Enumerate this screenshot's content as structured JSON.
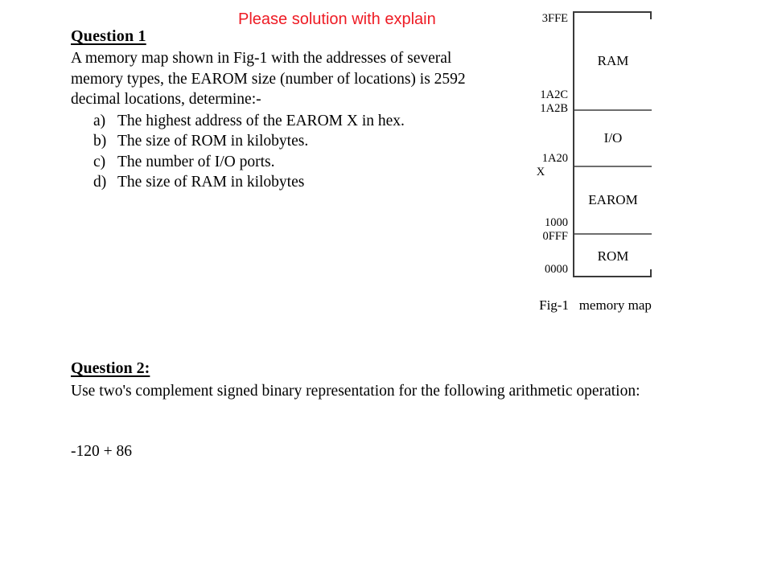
{
  "annotation": {
    "text": "Please solution with explain",
    "color": "#EE1B24"
  },
  "question1": {
    "heading": "Question 1",
    "paragraph": "A memory map shown  in Fig-1  with the addresses of several memory types, the  EAROM size (number of locations) is 2592 decimal locations, determine:-",
    "items": [
      {
        "marker": "a)",
        "text": "The highest address of the EAROM  X in hex."
      },
      {
        "marker": "b)",
        "text": "The size of ROM in kilobytes."
      },
      {
        "marker": "c)",
        "text": "The number of  I/O ports."
      },
      {
        "marker": "d)",
        "text": "The size of RAM in kilobytes"
      }
    ]
  },
  "figure": {
    "caption": "Fig-1   memory map",
    "segments": [
      {
        "label": "RAM"
      },
      {
        "label": "I/O"
      },
      {
        "label": "EAROM"
      },
      {
        "label": "ROM"
      }
    ],
    "addresses": [
      {
        "value": "3FFE"
      },
      {
        "value": "1A2C"
      },
      {
        "value": "1A2B"
      },
      {
        "value": "1A20"
      },
      {
        "value": "X"
      },
      {
        "value": "1000"
      },
      {
        "value": "0FFF"
      },
      {
        "value": "0000"
      }
    ]
  },
  "question2": {
    "heading": "Question 2:",
    "paragraph": "Use two's complement signed binary representation for the following arithmetic operation:",
    "expression": "-120 + 86"
  }
}
